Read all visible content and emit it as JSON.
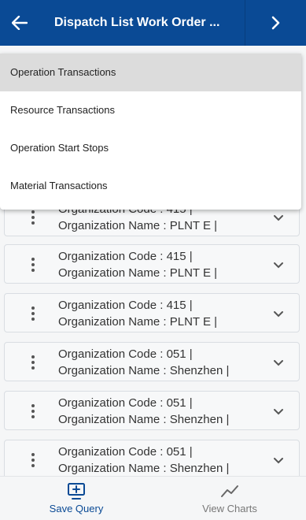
{
  "header": {
    "title": "Dispatch List Work Order ...",
    "back_icon": "arrow-left-icon",
    "next_icon": "chevron-right-icon"
  },
  "menu": {
    "items": [
      {
        "label": "Operation Transactions",
        "active": true
      },
      {
        "label": "Resource Transactions",
        "active": false
      },
      {
        "label": "Operation Start Stops",
        "active": false
      },
      {
        "label": "Material Transactions",
        "active": false
      }
    ]
  },
  "list": {
    "items": [
      {
        "line1": "Organization Code : 415 |",
        "line2": "Organization Name : PLNT E |"
      },
      {
        "line1": "Organization Code : 415 |",
        "line2": "Organization Name : PLNT E |"
      },
      {
        "line1": "Organization Code : 415 |",
        "line2": "Organization Name : PLNT E |"
      },
      {
        "line1": "Organization Code : 051 |",
        "line2": "Organization Name : Shenzhen |"
      },
      {
        "line1": "Organization Code : 051 |",
        "line2": "Organization Name : Shenzhen |"
      },
      {
        "line1": "Organization Code : 051 |",
        "line2": "Organization Name : Shenzhen |"
      }
    ]
  },
  "bottom_bar": {
    "save_query": "Save Query",
    "view_charts": "View Charts"
  },
  "colors": {
    "header": "#0a4a95",
    "active_tab": "#0a4a95",
    "inactive_tab": "#777777"
  }
}
